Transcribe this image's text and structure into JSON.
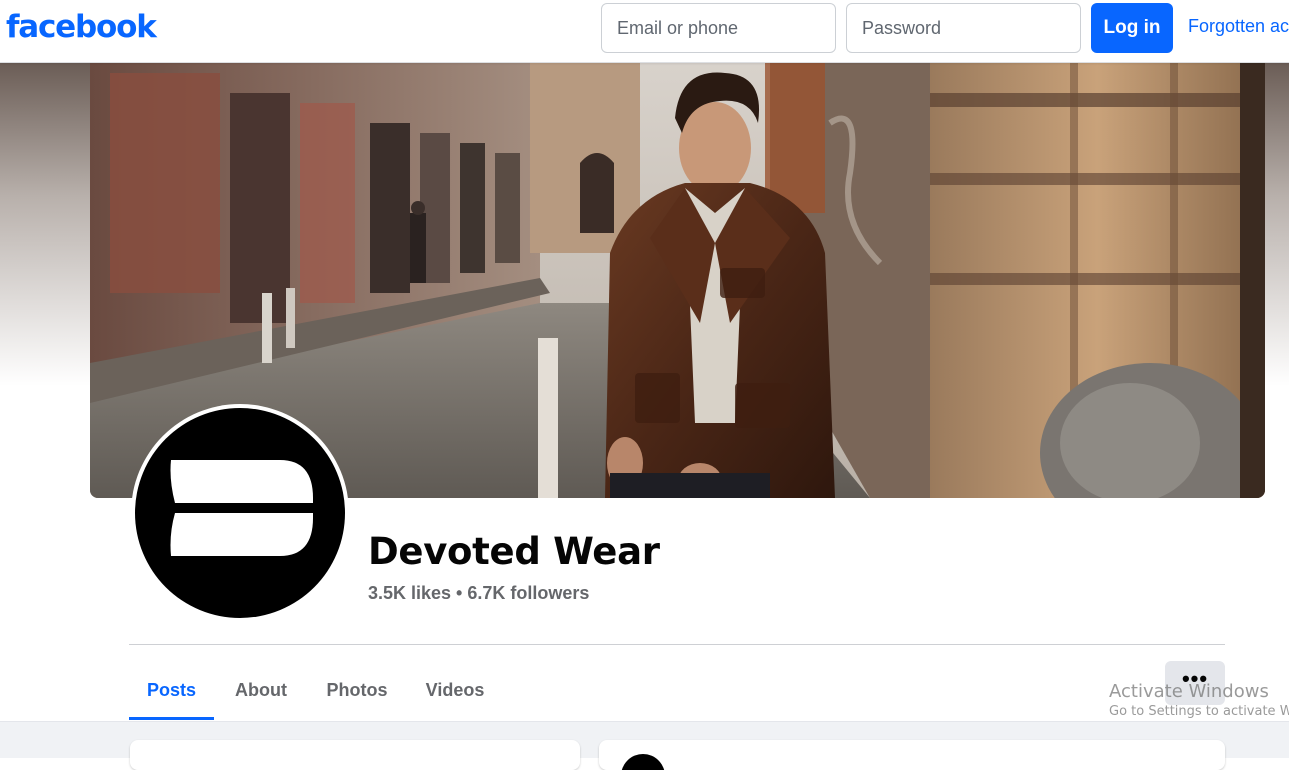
{
  "header": {
    "logo_text": "facebook",
    "email_placeholder": "Email or phone",
    "password_placeholder": "Password",
    "login_label": "Log in",
    "forgot_label": "Forgotten account?"
  },
  "profile": {
    "name": "Devoted Wear",
    "stats": "3.5K likes • 6.7K followers"
  },
  "tabs": [
    {
      "label": "Posts",
      "active": true
    },
    {
      "label": "About",
      "active": false
    },
    {
      "label": "Photos",
      "active": false
    },
    {
      "label": "Videos",
      "active": false
    }
  ],
  "more_button": {
    "label": "•••"
  },
  "watermark": {
    "title": "Activate Windows",
    "subtitle": "Go to Settings to activate Windows."
  },
  "colors": {
    "brand": "#0866ff",
    "text_primary": "#050505",
    "text_secondary": "#65676b",
    "page_bg": "#f0f2f5"
  },
  "icons": {
    "more": "ellipsis-icon"
  }
}
